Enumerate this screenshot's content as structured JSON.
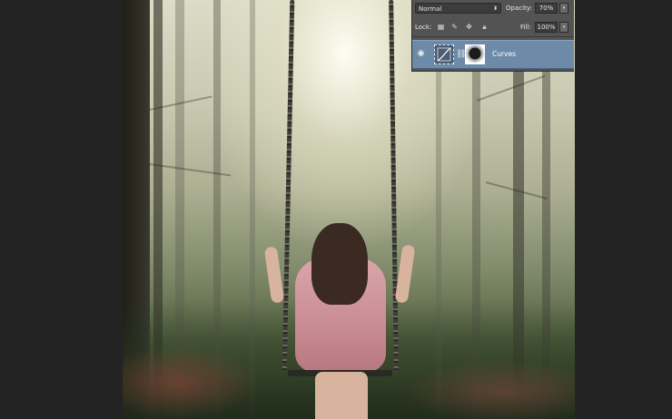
{
  "photo": {
    "description_free": true
  },
  "layers_panel": {
    "blend_mode": "Normal",
    "opacity_label": "Opacity:",
    "opacity_value": "70%",
    "lock_label": "Lock:",
    "fill_label": "Fill:",
    "fill_value": "100%",
    "layer": {
      "name": "Curves",
      "visible": true,
      "selected": true
    },
    "icons": {
      "blend_arrow": "updown-arrow-icon",
      "spinner": "dropdown-arrow-icon",
      "lock_transparency": "checkerboard-lock-icon",
      "lock_pixels": "brush-lock-icon",
      "lock_position": "move-lock-icon",
      "lock_all": "padlock-icon",
      "eye": "eye-icon",
      "curves_thumb": "curves-adjustment-icon",
      "chain": "chain-link-icon"
    },
    "colors": {
      "panel_bg": "#535353",
      "selected_row": "#6d8aa8"
    }
  }
}
